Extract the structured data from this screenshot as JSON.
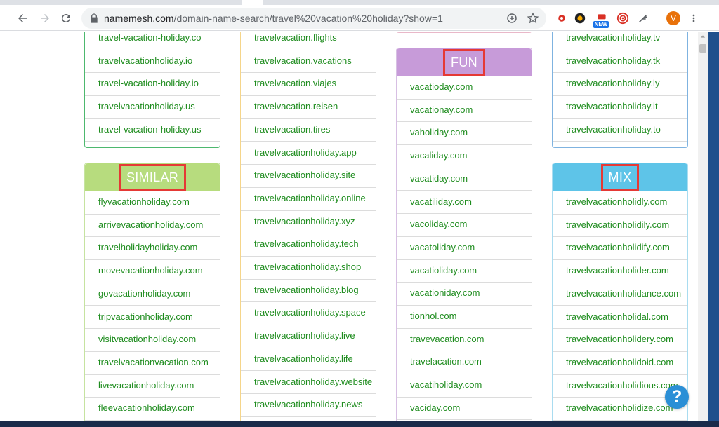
{
  "browser": {
    "url_host": "namemesh.com",
    "url_path": "/domain-name-search/travel%20vacation%20holiday?show=1",
    "new_badge": "NEW",
    "avatar_letter": "V"
  },
  "colors": {
    "similar_header": "#b7dc7e",
    "fun_header": "#c79bd9",
    "mix_header": "#5ec4e8",
    "link": "#1e8c1e",
    "highlight_box": "#e53935"
  },
  "columns": {
    "col1_top": [
      "travel-vacation-holiday.co",
      "travelvacationholiday.io",
      "travel-vacation-holiday.io",
      "travelvacationholiday.us",
      "travel-vacation-holiday.us"
    ],
    "similar": {
      "title": "SIMILAR",
      "items": [
        "flyvacationholiday.com",
        "arrivevacationholiday.com",
        "travelholidayholiday.com",
        "movevacationholiday.com",
        "govacationholiday.com",
        "tripvacationholiday.com",
        "visitvacationholiday.com",
        "travelvacationvacation.com",
        "livevacationholiday.com",
        "fleevacationholiday.com"
      ]
    },
    "col2": [
      "travelvacation.flights",
      "travelvacation.vacations",
      "travelvacation.viajes",
      "travelvacation.reisen",
      "travelvacation.tires",
      "travelvacationholiday.app",
      "travelvacationholiday.site",
      "travelvacationholiday.online",
      "travelvacationholiday.xyz",
      "travelvacationholiday.tech",
      "travelvacationholiday.shop",
      "travelvacationholiday.blog",
      "travelvacationholiday.space",
      "travelvacationholiday.live",
      "travelvacationholiday.life",
      "travelvacationholiday.website",
      "travelvacationholiday.news"
    ],
    "fun": {
      "title": "FUN",
      "items": [
        "vacatioday.com",
        "vacationay.com",
        "vaholiday.com",
        "vacaliday.com",
        "vacatiday.com",
        "vacatiliday.com",
        "vacoliday.com",
        "vacatoliday.com",
        "vacatioliday.com",
        "vacationiday.com",
        "tionhol.com",
        "travevacation.com",
        "travelacation.com",
        "vacatiholiday.com",
        "vaciday.com"
      ]
    },
    "col4_top": [
      "travelvacationholiday.tv",
      "travelvacationholiday.tk",
      "travelvacationholiday.ly",
      "travelvacationholiday.it",
      "travelvacationholiday.to"
    ],
    "mix": {
      "title": "MIX",
      "items": [
        "travelvacationholidly.com",
        "travelvacationholidily.com",
        "travelvacationholidify.com",
        "travelvacationholider.com",
        "travelvacationholidance.com",
        "travelvacationholidal.com",
        "travelvacationholidery.com",
        "travelvacationholidoid.com",
        "travelvacationholidious.com",
        "travelvacationholidize.com"
      ]
    }
  },
  "help_label": "?"
}
